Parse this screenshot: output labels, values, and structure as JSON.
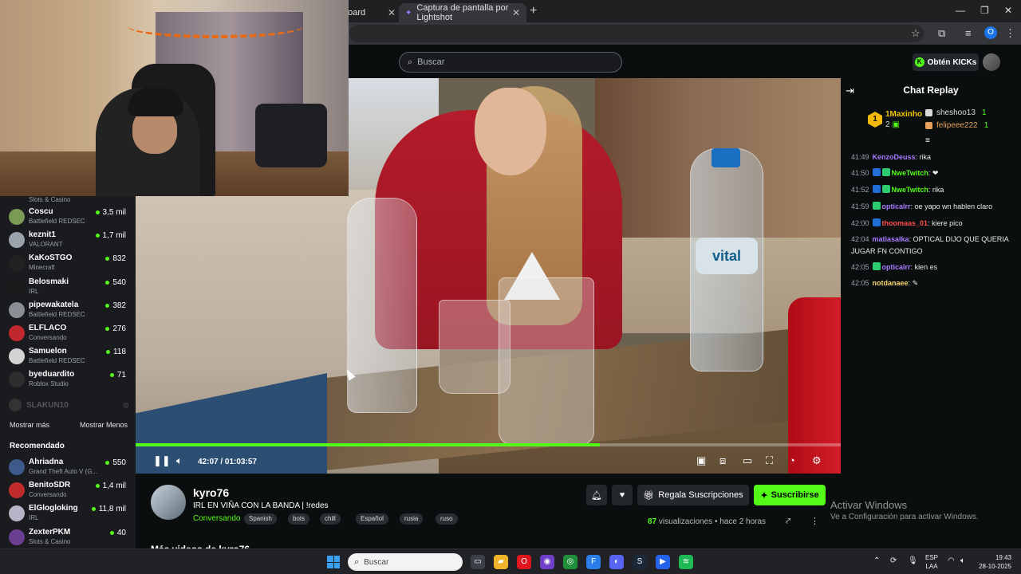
{
  "browser": {
    "tab1_title": "board",
    "tab2_title": "Captura de pantalla por Lightshot",
    "new_tab_icon": "+",
    "window_controls": [
      "minimize-icon",
      "restore-icon",
      "close-icon"
    ],
    "profile_letter": "O"
  },
  "header": {
    "search_placeholder": "Buscar",
    "kicks_button": "Obtén KICKs"
  },
  "sidebar": {
    "previous_category": "Slots & Casino",
    "following": [
      {
        "name": "Coscu",
        "category": "Battlefield REDSEC",
        "viewers": "3,5 mil",
        "color": "#7a9b55"
      },
      {
        "name": "keznit1",
        "category": "VALORANT",
        "viewers": "1,7 mil",
        "color": "#9aa3ab"
      },
      {
        "name": "KaKoSTGO",
        "category": "Minecraft",
        "viewers": "832",
        "color": "#222222"
      },
      {
        "name": "Belosmaki",
        "category": "IRL",
        "viewers": "540",
        "color": "#1b1b1b"
      },
      {
        "name": "pipewakatela",
        "category": "Battlefield REDSEC",
        "viewers": "382",
        "color": "#8a8f95"
      },
      {
        "name": "ELFLACO",
        "category": "Conversando",
        "viewers": "276",
        "color": "#c1282e"
      },
      {
        "name": "Samuelon",
        "category": "Battlefield REDSEC",
        "viewers": "118",
        "color": "#d4d4d4"
      },
      {
        "name": "byeduardito",
        "category": "Roblox Studio",
        "viewers": "71",
        "color": "#2d2d2d"
      }
    ],
    "offline_channel": "SLAKUN10",
    "show_more": "Mostrar más",
    "show_less": "Mostrar Menos",
    "recommended_title": "Recomendado",
    "recommended": [
      {
        "name": "Ahriadna",
        "category": "Grand Theft Auto V (G...",
        "viewers": "550",
        "color": "#3d5a8a"
      },
      {
        "name": "BenitoSDR",
        "category": "Conversando",
        "viewers": "1,4 mil",
        "color": "#c22b2b"
      },
      {
        "name": "ElGlogloking",
        "category": "IRL",
        "viewers": "11,8 mil",
        "color": "#b8b3c7"
      },
      {
        "name": "ZexterPKM",
        "category": "Slots & Casino",
        "viewers": "40",
        "color": "#6a3f8f"
      }
    ]
  },
  "video": {
    "current_time": "42:07",
    "duration": "01:03:57",
    "progress_fraction": 0.658,
    "bottle_label": "vital"
  },
  "chat": {
    "title": "Chat Replay",
    "leaderboard": {
      "first_name": "1Maxinho",
      "first_count": "2",
      "first_rank": "1",
      "others": [
        {
          "name": "sheshoo13",
          "count": "1",
          "color": "#d9d9d9"
        },
        {
          "name": "felipeee222",
          "count": "1",
          "color": "#e6a15a"
        }
      ]
    },
    "messages": [
      {
        "time": "41:49",
        "user": "KenzoDeuss",
        "color": "#a97bff",
        "text": "rika",
        "badges": []
      },
      {
        "time": "41:50",
        "user": "NweTwitch",
        "color": "#53fc18",
        "text": "",
        "emote": "❤",
        "badges": [
          "#1f6fd6",
          "#2ecc71"
        ]
      },
      {
        "time": "41:52",
        "user": "NweTwitch",
        "color": "#53fc18",
        "text": "rika",
        "badges": [
          "#1f6fd6",
          "#2ecc71"
        ]
      },
      {
        "time": "41:59",
        "user": "opticalrr",
        "color": "#a97bff",
        "text": "oe yapo wn hablen claro",
        "badges": [
          "#2ecc71"
        ]
      },
      {
        "time": "42:00",
        "user": "thoomaas_01",
        "color": "#ff4d4d",
        "text": "kiere pico",
        "badges": [
          "#1f6fd6"
        ]
      },
      {
        "time": "42:04",
        "user": "matiasalka",
        "color": "#a97bff",
        "text": "OPTICAL DIJO QUE QUERIA JUGAR FN CONTIGO",
        "badges": []
      },
      {
        "time": "42:05",
        "user": "opticalrr",
        "color": "#a97bff",
        "text": "kien es",
        "badges": [
          "#2ecc71"
        ]
      },
      {
        "time": "42:05",
        "user": "notdanaee",
        "color": "#f5d76e",
        "text": "",
        "emote": "✎",
        "badges": []
      }
    ]
  },
  "stream": {
    "streamer": "kyro76",
    "title": "IRL EN VIÑA CON LA BANDA | !redes",
    "category": "Conversando",
    "tags": [
      "Spanish",
      "bots",
      "chill",
      "Español",
      "rusia",
      "ruso"
    ],
    "gift_subs": "Regala Suscripciones",
    "subscribe": "Suscribirse",
    "views_count": "87",
    "views_label": "visualizaciones",
    "time_ago": "hace 2 horas",
    "more_videos": "Más videos de kyro76"
  },
  "windows_activation": {
    "line1": "Activar Windows",
    "line2": "Ve a Configuración para activar Windows."
  },
  "taskbar": {
    "search_placeholder": "Buscar",
    "lang_top": "ESP",
    "lang_bottom": "LAA",
    "time": "19:43",
    "date": "28-10-2025",
    "apps": [
      {
        "name": "task-view-icon",
        "color": "#3b3f46",
        "glyph": "▭"
      },
      {
        "name": "file-explorer-icon",
        "color": "#f0b429",
        "glyph": "▰"
      },
      {
        "name": "opera-icon",
        "color": "#e0161e",
        "glyph": "O"
      },
      {
        "name": "github-desktop-icon",
        "color": "#6e40c9",
        "glyph": "◉"
      },
      {
        "name": "chrome-icon",
        "color": "#1f8f3a",
        "glyph": "◎"
      },
      {
        "name": "framer-icon",
        "color": "#2b7de9",
        "glyph": "F"
      },
      {
        "name": "discord-icon",
        "color": "#5865f2",
        "glyph": "◐"
      },
      {
        "name": "steam-icon",
        "color": "#1b2838",
        "glyph": "S"
      },
      {
        "name": "launcher-icon",
        "color": "#2563eb",
        "glyph": "▶"
      },
      {
        "name": "spotify-icon",
        "color": "#1db954",
        "glyph": "≋"
      }
    ]
  }
}
